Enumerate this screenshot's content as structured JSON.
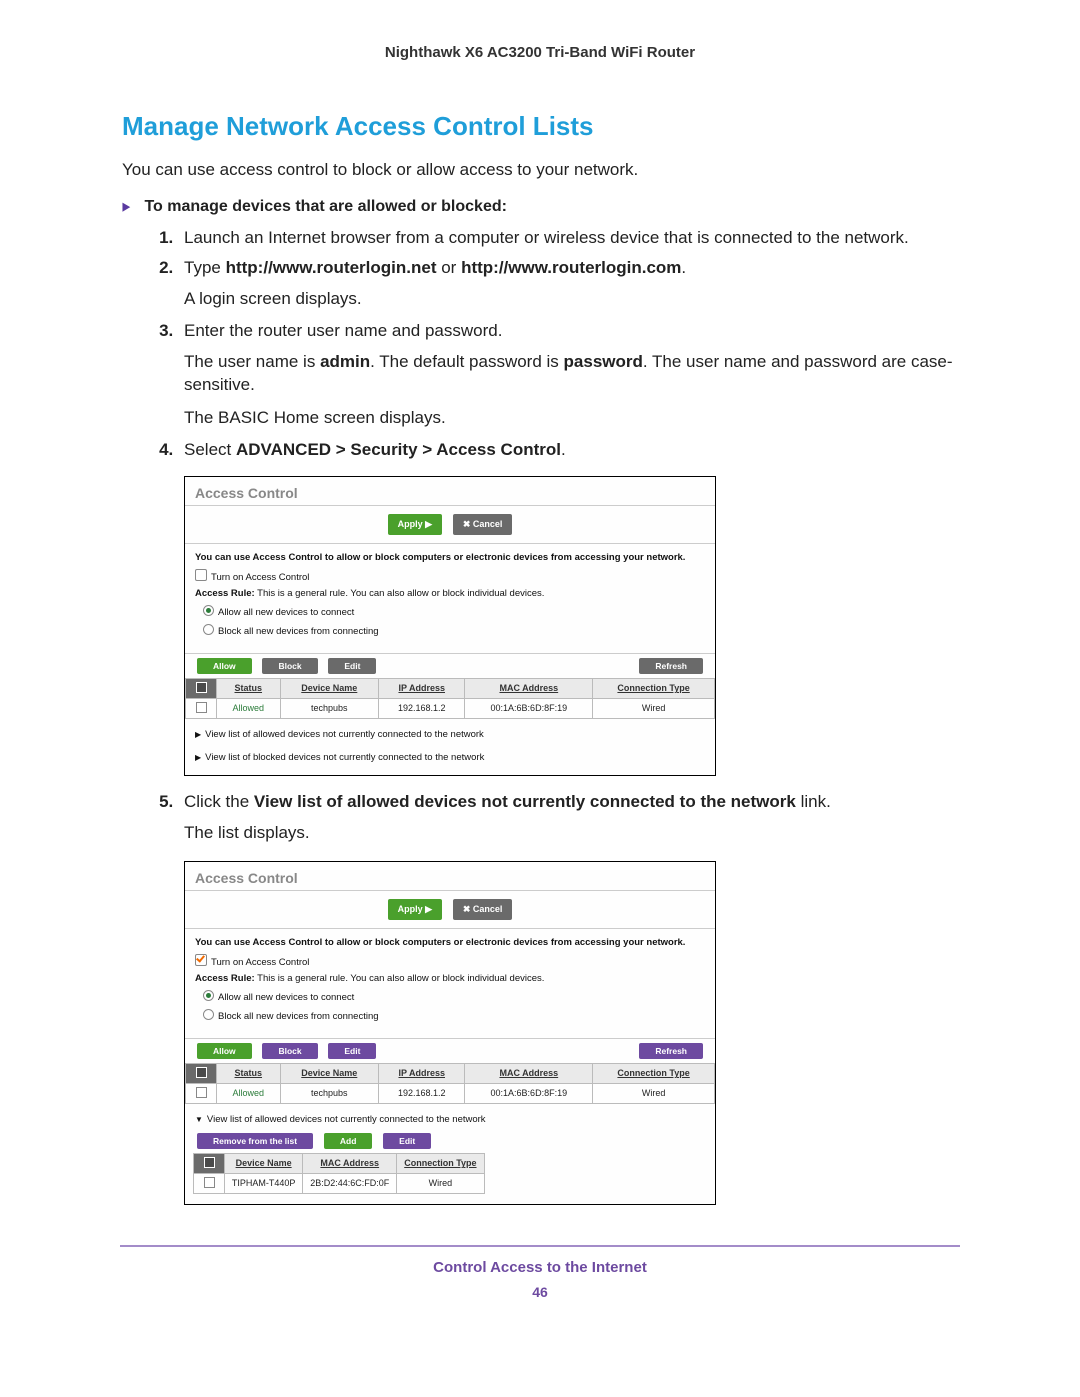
{
  "header": "Nighthawk X6 AC3200 Tri-Band WiFi Router",
  "title": "Manage Network Access Control Lists",
  "intro": "You can use access control to block or allow access to your network.",
  "procedure": "To manage devices that are allowed or blocked:",
  "steps": {
    "s1": "Launch an Internet browser from a computer or wireless device that is connected to the network.",
    "s2a": "Type ",
    "s2b": "http://www.routerlogin.net",
    "s2c": " or ",
    "s2d": "http://www.routerlogin.com",
    "s2e": ".",
    "s2p": "A login screen displays.",
    "s3": "Enter the router user name and password.",
    "s3p1a": "The user name is ",
    "s3p1b": "admin",
    "s3p1c": ". The default password is ",
    "s3p1d": "password",
    "s3p1e": ". The user name and password are case-sensitive.",
    "s3p2": "The BASIC Home screen displays.",
    "s4a": "Select ",
    "s4b": "ADVANCED > Security > Access Control",
    "s4c": ".",
    "s5a": "Click the ",
    "s5b": "View list of allowed devices not currently connected to the network",
    "s5c": " link.",
    "s5p": "The list displays."
  },
  "ui": {
    "panel_title": "Access Control",
    "apply": "Apply ▶",
    "cancel": "✖ Cancel",
    "desc": "You can use Access Control to allow or block computers or electronic devices from accessing your network.",
    "turn_on": "Turn on Access Control",
    "rule_label": "Access Rule:",
    "rule_desc": " This is a general rule. You can also allow or block individual devices.",
    "radio_allow": "Allow all new devices to connect",
    "radio_block": "Block all new devices from connecting",
    "btn_allow": "Allow",
    "btn_block": "Block",
    "btn_edit": "Edit",
    "btn_refresh": "Refresh",
    "btn_add": "Add",
    "btn_remove": "Remove from the list",
    "th_status": "Status",
    "th_device": "Device Name",
    "th_ip": "IP Address",
    "th_mac": "MAC Address",
    "th_conn": "Connection Type",
    "row": {
      "status": "Allowed",
      "device": "techpubs",
      "ip": "192.168.1.2",
      "mac": "00:1A:6B:6D:8F:19",
      "conn": "Wired"
    },
    "disclosure_allowed": "View list of allowed devices not currently connected to the network",
    "disclosure_blocked": "View list of blocked devices not currently connected to the network",
    "sub_row": {
      "device": "TIPHAM-T440P",
      "mac": "2B:D2:44:6C:FD:0F",
      "conn": "Wired"
    }
  },
  "footer": "Control Access to the Internet",
  "page": "46"
}
